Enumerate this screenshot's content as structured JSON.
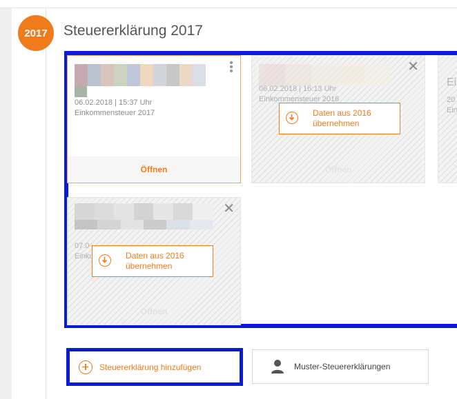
{
  "section": {
    "year_badge": "2017",
    "title": "Steuererklärung 2017"
  },
  "cards": [
    {
      "date": "06.02.2018 | 15:37 Uhr",
      "type": "Einkommensteuer 2017",
      "footer": "Öffnen",
      "state": "active",
      "menu_icon": "kebab-menu-icon"
    },
    {
      "date": "06.02.2018 | 16:13 Uhr",
      "type": "Einkommensteuer 2016",
      "footer": "Öffnen",
      "state": "disabled",
      "import_label_line1": "Daten aus 2016",
      "import_label_line2": "übernehmen",
      "close_icon": "close-icon"
    },
    {
      "date_partial": "20",
      "type_partial": "Ein",
      "title_partial": "Ei",
      "state": "disabled"
    },
    {
      "date_partial": "07.0",
      "type_partial": "Einku",
      "footer": "Öffnen",
      "state": "disabled",
      "import_label_line1": "Daten aus 2016",
      "import_label_line2": "übernehmen",
      "close_icon": "close-icon"
    }
  ],
  "actions": {
    "add_label": "Steuererklärung hinzufügen",
    "muster_label": "Muster-Steuererklärungen"
  },
  "colors": {
    "accent": "#f07b1c",
    "highlight": "#0b1ad9"
  }
}
